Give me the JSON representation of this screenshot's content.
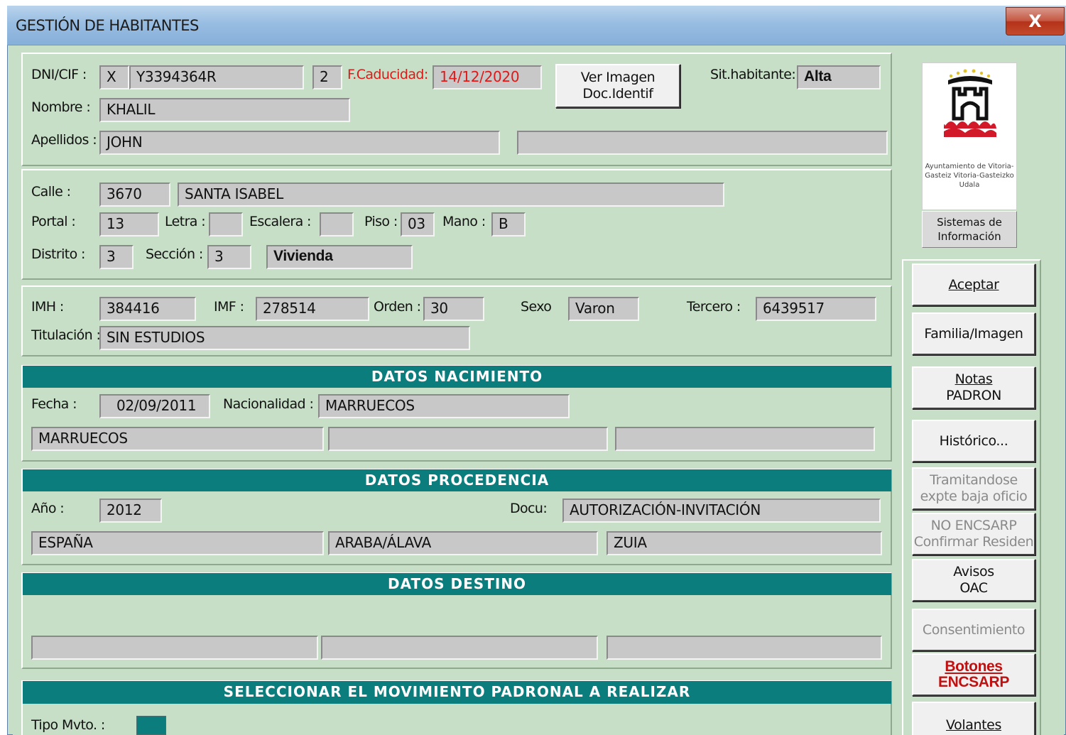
{
  "window": {
    "title": "GESTIÓN DE HABITANTES",
    "close": "X"
  },
  "ident": {
    "dni_label": "DNI/CIF :",
    "dni_type": "X",
    "dni_value": "Y3394364R",
    "dni_seq": "2",
    "caducidad_label": "F.Caducidad:",
    "caducidad_value": "14/12/2020",
    "ver_imagen_line1": "Ver Imagen",
    "ver_imagen_line2": "Doc.Identif",
    "sit_label": "Sit.habitante:",
    "sit_value": "Alta",
    "nombre_label": "Nombre :",
    "nombre_value": "KHALIL",
    "apellidos_label": "Apellidos :",
    "apellido1": "JOHN",
    "apellido2": ""
  },
  "address": {
    "calle_label": "Calle :",
    "calle_code": "3670",
    "calle_name": "SANTA ISABEL",
    "portal_label": "Portal :",
    "portal_value": "13",
    "letra_label": "Letra :",
    "letra_value": "",
    "escalera_label": "Escalera :",
    "escalera_value": "",
    "piso_label": "Piso :",
    "piso_value": "03",
    "mano_label": "Mano :",
    "mano_value": "B",
    "distrito_label": "Distrito :",
    "distrito_value": "3",
    "seccion_label": "Sección :",
    "seccion_value": "3",
    "tipo_value": "Vivienda"
  },
  "ids": {
    "imh_label": "IMH :",
    "imh_value": "384416",
    "imf_label": "IMF :",
    "imf_value": "278514",
    "orden_label": "Orden :",
    "orden_value": "30",
    "sexo_label": "Sexo",
    "sexo_value": "Varon",
    "tercero_label": "Tercero :",
    "tercero_value": "6439517",
    "titulacion_label": "Titulación :",
    "titulacion_value": "SIN ESTUDIOS"
  },
  "nacimiento": {
    "header": "DATOS NACIMIENTO",
    "fecha_label": "Fecha :",
    "fecha_value": "02/09/2011",
    "nacionalidad_label": "Nacionalidad :",
    "nacionalidad_value": "MARRUECOS",
    "lugar1": "MARRUECOS",
    "lugar2": "",
    "lugar3": ""
  },
  "procedencia": {
    "header": "DATOS PROCEDENCIA",
    "anio_label": "Año :",
    "anio_value": "2012",
    "docu_label": "Docu:",
    "docu_value": "AUTORIZACIÓN-INVITACIÓN",
    "pais": "ESPAÑA",
    "provincia": "ARABA/ÁLAVA",
    "municipio": "ZUIA"
  },
  "destino": {
    "header": "DATOS DESTINO",
    "f1": "",
    "f2": "",
    "f3": ""
  },
  "movimiento": {
    "header": "SELECCIONAR EL MOVIMIENTO PADRONAL A REALIZAR",
    "tipo_label": "Tipo Mvto. :"
  },
  "logo": {
    "text": "Ayuntamiento de Vitoria-Gasteiz Vitoria-Gasteizko Udala",
    "sistemas_line1": "Sistemas de",
    "sistemas_line2": "Información"
  },
  "buttons": {
    "aceptar": "Aceptar",
    "familia": "Familia/Imagen",
    "notas_line1": "Notas",
    "notas_line2": "PADRON",
    "historico": "Histórico...",
    "tramitandose_line1": "Tramitandose",
    "tramitandose_line2": "expte baja oficio",
    "noencsarp_line1": "NO ENCSARP",
    "noencsarp_line2": "Confirmar Residen",
    "avisos_line1": "Avisos",
    "avisos_line2": "OAC",
    "consentimiento": "Consentimiento",
    "botones_line1": "Botones",
    "botones_line2": "ENCSARP",
    "volantes": "Volantes"
  },
  "colors": {
    "form_bg": "#c6dfc6",
    "header_teal": "#0b7d7d",
    "field_bg": "#c8c8c8",
    "warning_red": "#e01818",
    "title_blue": "#98bde2"
  }
}
